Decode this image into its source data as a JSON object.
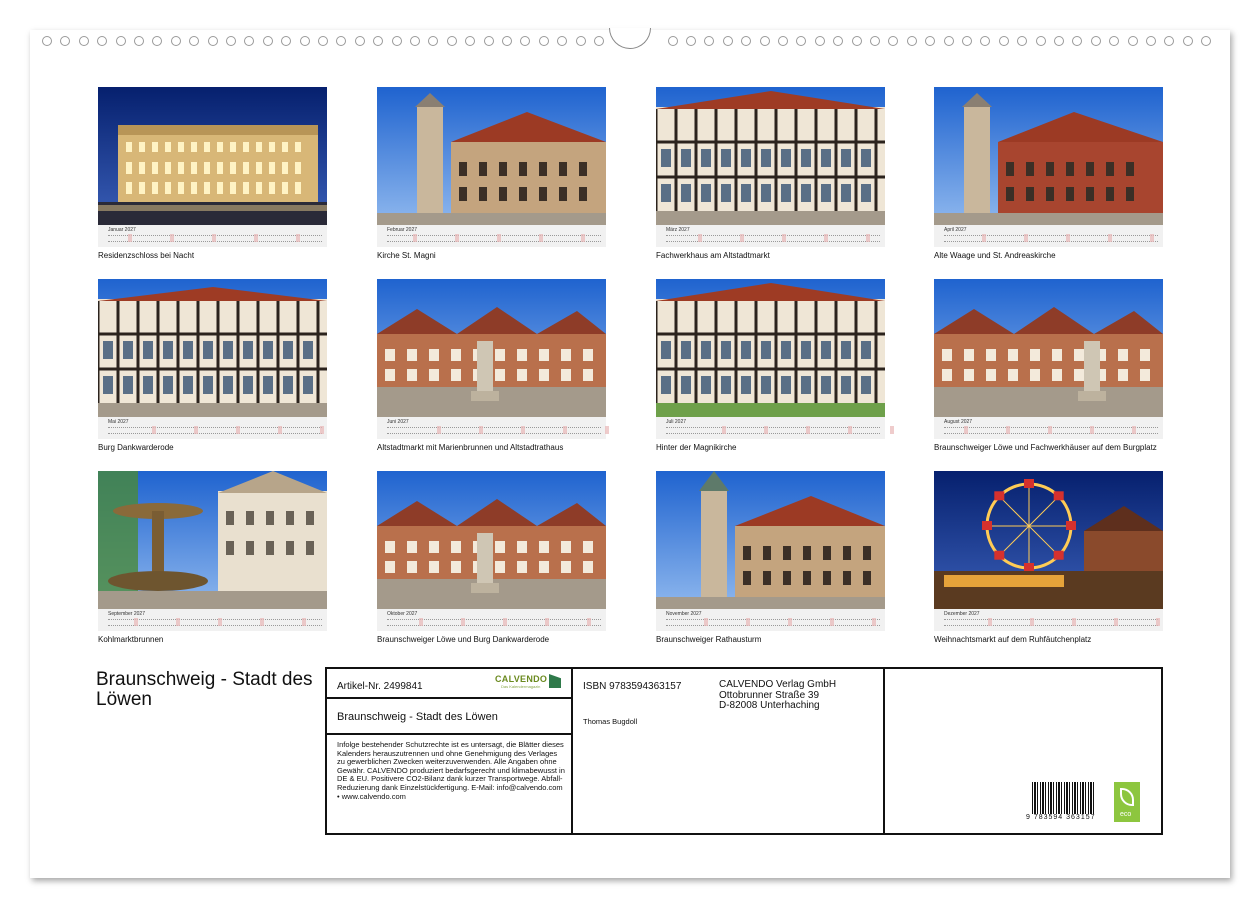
{
  "calendar": {
    "title": "Braunschweig - Stadt des Löwen",
    "months": [
      {
        "month_label": "Januar 2027",
        "caption": "Residenzschloss bei Nacht",
        "image": "palace-at-night"
      },
      {
        "month_label": "Februar 2027",
        "caption": "Kirche St. Magni",
        "image": "church-st-magni"
      },
      {
        "month_label": "März 2027",
        "caption": "Fachwerkhaus am Altstadtmarkt",
        "image": "half-timbered-house"
      },
      {
        "month_label": "April 2027",
        "caption": "Alte Waage und St. Andreaskirche",
        "image": "old-scales-house-and-church"
      },
      {
        "month_label": "Mai 2027",
        "caption": "Burg Dankwarderode",
        "image": "castle-courtyard"
      },
      {
        "month_label": "Juni 2027",
        "caption": "Altstadtmarkt mit Marienbrunnen und Altstadtrathaus",
        "image": "market-square-fountain"
      },
      {
        "month_label": "Juli 2027",
        "caption": "Hinter der Magnikirche",
        "image": "half-timbered-street"
      },
      {
        "month_label": "August 2027",
        "caption": "Braunschweiger Löwe und Fachwerkhäuser auf dem Burgplatz",
        "image": "lion-monument-square"
      },
      {
        "month_label": "September 2027",
        "caption": "Kohlmarktbrunnen",
        "image": "fountain-and-facades"
      },
      {
        "month_label": "Oktober 2027",
        "caption": "Braunschweiger Löwe und Burg Dankwarderode",
        "image": "lion-and-castle"
      },
      {
        "month_label": "November 2027",
        "caption": "Braunschweiger Rathausturm",
        "image": "town-hall-tower"
      },
      {
        "month_label": "Dezember 2027",
        "caption": "Weihnachtsmarkt auf dem Ruhfäutchenplatz",
        "image": "christmas-market-ferris-wheel"
      }
    ]
  },
  "info": {
    "article_number": "Artikel-Nr. 2499841",
    "logo_text": "CALVENDO",
    "logo_tagline": "Das Kalendermagazin",
    "subtitle": "Braunschweig - Stadt des Löwen",
    "legal_text": "Infolge bestehender Schutzrechte ist es untersagt, die Blätter dieses Kalenders herauszutrennen und ohne Genehmigung des Verlages zu gewerblichen Zwecken weiterzuverwenden. Alle Angaben ohne Gewähr. CALVENDO produziert bedarfsgerecht und klimabewusst in DE & EU. Positivere CO2-Bilanz dank kurzer Transportwege. Abfall-Reduzierung dank Einzelstückfertigung. E-Mail: info@calvendo.com • www.calvendo.com",
    "isbn": "ISBN 9783594363157",
    "author": "Thomas Bugdoll",
    "publisher_name": "CALVENDO Verlag GmbH",
    "publisher_street": "Ottobrunner Straße 39",
    "publisher_city": "D-82008 Unterhaching",
    "barcode_number": "9 783594 363157",
    "eco_label": "eco"
  },
  "colors": {
    "sky": "#2b6fd6",
    "night_sky": "#0a2f8a",
    "roof": "#b4452c",
    "stone": "#c9b79c",
    "eco_green": "#8dc63f",
    "calendar_sunday": "#e8b7b7"
  }
}
